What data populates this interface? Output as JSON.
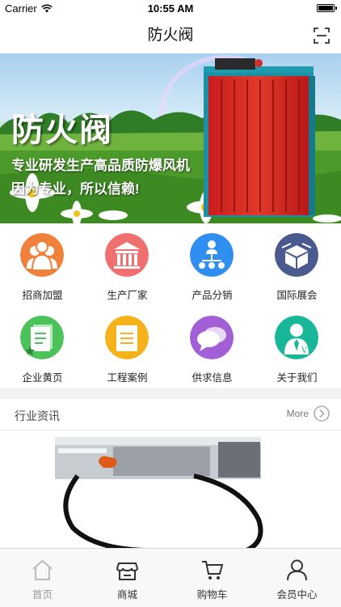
{
  "status_bar": {
    "carrier": "Carrier",
    "time": "10:55 AM",
    "battery_level": 1.0
  },
  "nav": {
    "title": "防火阀",
    "scan_icon": "scan-icon"
  },
  "banner": {
    "title": "防火阀",
    "subtitle_line1": "专业研发生产高品质防爆风机",
    "subtitle_line2": "因为专业，所以信赖!"
  },
  "grid": {
    "items": [
      {
        "label": "招商加盟",
        "icon": "people-icon",
        "color": "#f0813a"
      },
      {
        "label": "生产厂家",
        "icon": "building-icon",
        "color": "#f07070"
      },
      {
        "label": "产品分销",
        "icon": "network-icon",
        "color": "#2f8ff0"
      },
      {
        "label": "国际展会",
        "icon": "box-icon",
        "color": "#4a5a8e"
      },
      {
        "label": "企业黄页",
        "icon": "document-star-icon",
        "color": "#4cc35a"
      },
      {
        "label": "工程案例",
        "icon": "folder-icon",
        "color": "#f5b21a"
      },
      {
        "label": "供求信息",
        "icon": "chat-bubbles-icon",
        "color": "#a35fd6"
      },
      {
        "label": "关于我们",
        "icon": "person-tie-icon",
        "color": "#18b79a"
      }
    ]
  },
  "news": {
    "title": "行业资讯",
    "more_label": "More"
  },
  "tabs": [
    {
      "label": "首页",
      "icon": "home-icon"
    },
    {
      "label": "商城",
      "icon": "store-icon"
    },
    {
      "label": "购物车",
      "icon": "cart-icon"
    },
    {
      "label": "会员中心",
      "icon": "user-icon"
    }
  ]
}
